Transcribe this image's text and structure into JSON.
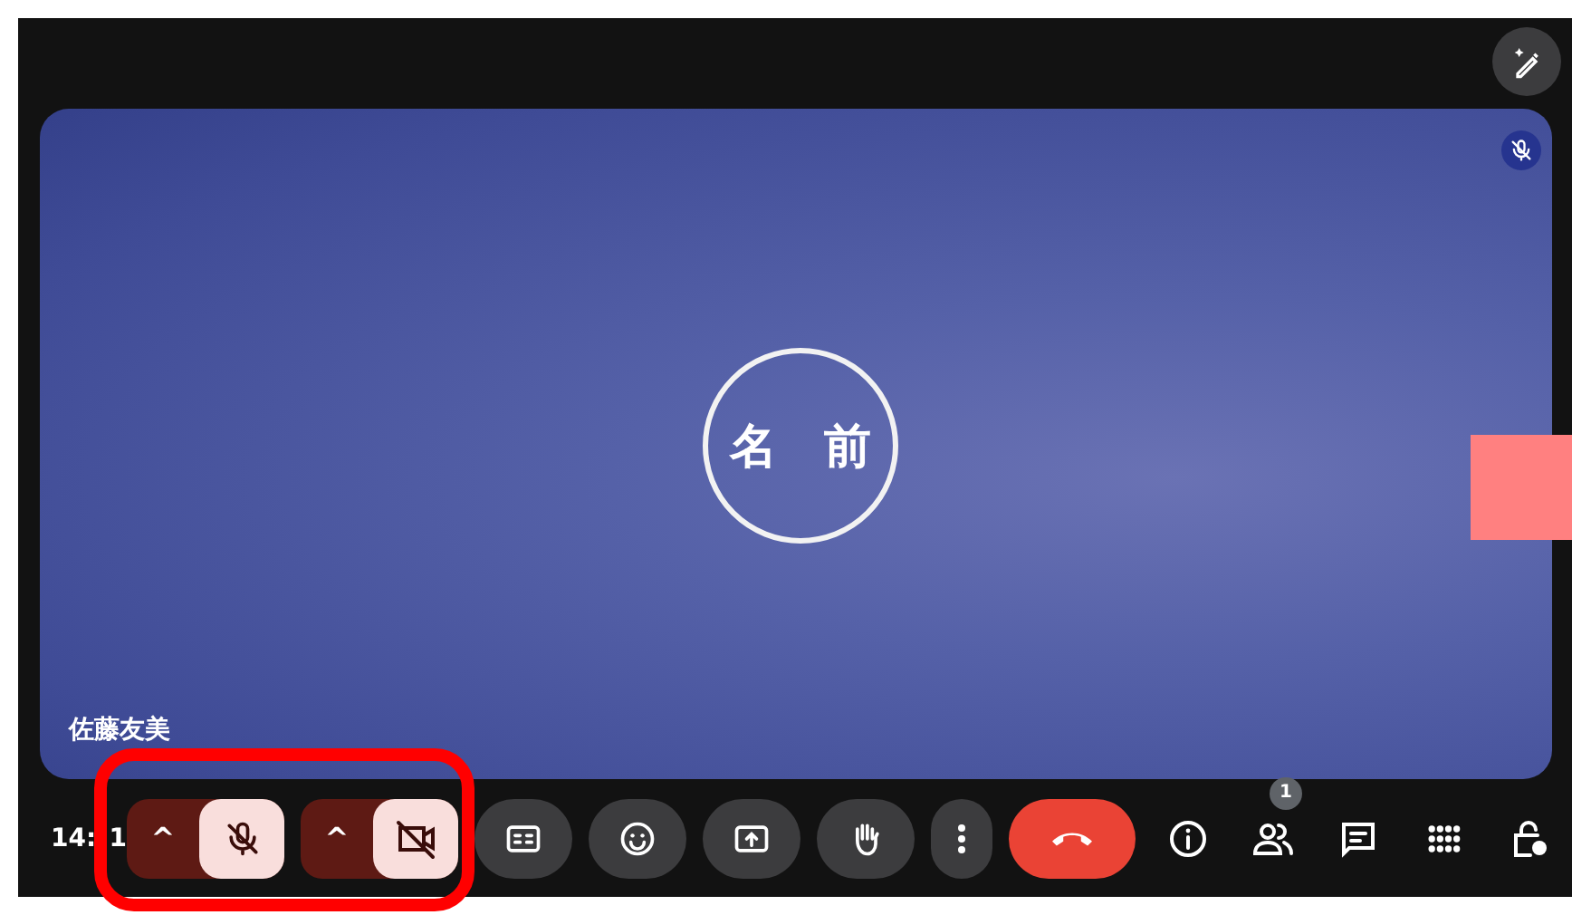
{
  "participant": {
    "initials": "名　前",
    "name": "佐藤友美",
    "muted": true
  },
  "clock": [
    "14:",
    "1"
  ],
  "controls": [
    {
      "kind": "split",
      "chevron": "^"
    },
    {
      "kind": "split",
      "chevron": "^"
    },
    {
      "kind": "round"
    },
    {
      "kind": "round"
    },
    {
      "kind": "round"
    },
    {
      "kind": "round"
    },
    {
      "kind": "narrow"
    },
    {
      "kind": "hangup"
    }
  ],
  "people_count": "1"
}
